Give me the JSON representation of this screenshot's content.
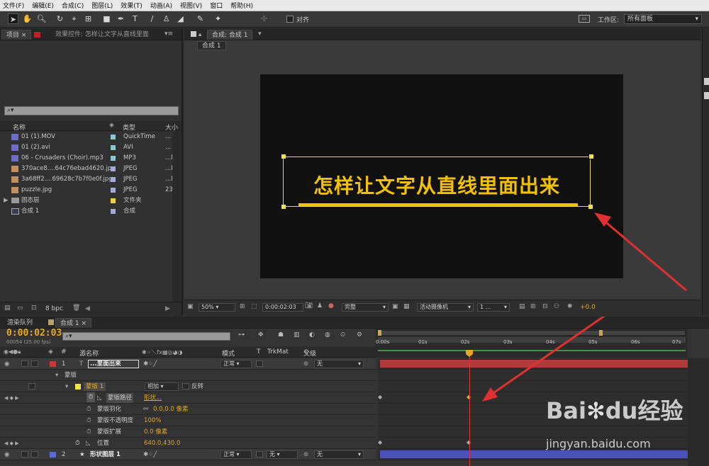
{
  "menu": [
    "文件(F)",
    "编辑(E)",
    "合成(C)",
    "图层(L)",
    "效果(T)",
    "动画(A)",
    "视图(V)",
    "窗口",
    "帮助(H)"
  ],
  "toolbar": {
    "align_label": "对齐",
    "workspace_label": "工作区:",
    "workspace_value": "所有面板"
  },
  "project": {
    "tab_project": "项目 ×",
    "tab_effects": "效果控件: 怎样让文字从直线里面",
    "search_placeholder": "⌕▾",
    "columns": {
      "name": "名称",
      "type": "类型",
      "size": "大小"
    },
    "items": [
      {
        "name": "01 (1).MOV",
        "type": "QuickTime",
        "size": "...",
        "color": "#8fc7c9",
        "icon": "video-file-icon"
      },
      {
        "name": "01 (2).avi",
        "type": "AVI",
        "size": "...",
        "color": "#8fc7c9",
        "icon": "video-file-icon"
      },
      {
        "name": "06 - Crusaders (Choir).mp3",
        "type": "MP3",
        "size": "...M",
        "color": "#8fc7c9",
        "icon": "audio-file-icon"
      },
      {
        "name": "370ace8....64c76ebad4620.jpg",
        "type": "JPEG",
        "size": "...M",
        "color": "#a9a9d8",
        "icon": "image-file-icon"
      },
      {
        "name": "3a68ff2....69628c7b7f0e0f.jpg",
        "type": "JPEG",
        "size": "...M",
        "color": "#a9a9d8",
        "icon": "image-file-icon"
      },
      {
        "name": "puzzle.jpg",
        "type": "JPEG",
        "size": "23",
        "color": "#a9a9d8",
        "icon": "image-file-icon"
      },
      {
        "name": "固态层",
        "type": "文件夹",
        "size": "",
        "color": "#e8d24a",
        "icon": "folder-icon"
      },
      {
        "name": "合成 1",
        "type": "合成",
        "size": "",
        "color": "#a9a9d8",
        "icon": "composition-icon"
      }
    ],
    "bpc": "8 bpc"
  },
  "composition": {
    "tab": "合成: 合成 1",
    "subtab": "合成 1",
    "text": "怎样让文字从直线里面出来",
    "zoom": "50%",
    "timecode": "0:00:02:03",
    "quality": "完整",
    "camera": "活动摄像机",
    "views": "1 ...",
    "exposure": "+0.0"
  },
  "timeline": {
    "tab_render": "渲染队列",
    "tab_comp": "合成 1",
    "current_time": "0:00:02:03",
    "frame_info": "00054 (25.00 fps)",
    "headers": {
      "source": "源名称",
      "mode": "模式",
      "t": "T",
      "trkmat": "TrkMat",
      "parent": "父级"
    },
    "ruler": [
      "0:00s",
      "01s",
      "02s",
      "03s",
      "04s",
      "05s",
      "06s",
      "07s"
    ],
    "layer1": {
      "num": "1",
      "name": "...里面出来",
      "mode": "正常",
      "parent": "无"
    },
    "masks_group": "蒙版",
    "mask1": {
      "name": "蒙版 1",
      "mode": "相加",
      "invert": "反转"
    },
    "props": [
      {
        "name": "蒙版路径",
        "value": "形状..."
      },
      {
        "name": "蒙版羽化",
        "value": "0.0,0.0 像素"
      },
      {
        "name": "蒙版不透明度",
        "value": "100%"
      },
      {
        "name": "蒙版扩展",
        "value": "0.0 像素"
      },
      {
        "name": "位置",
        "value": "640.0,430.0"
      }
    ],
    "layer2": {
      "num": "2",
      "name": "形状图层 1",
      "mode": "正常",
      "trkmat": "无",
      "parent": "无"
    },
    "layer1_color": "#c43a3a",
    "layer2_color": "#4a55b0"
  },
  "watermark": "Baidu经验 jingyan.baidu.com",
  "colors": {
    "accent": "#e3a82a",
    "text_yellow": "#f2c200",
    "bar_red": "#b23a3a",
    "bar_blue": "#4a52b8",
    "arrow": "#e03030"
  }
}
